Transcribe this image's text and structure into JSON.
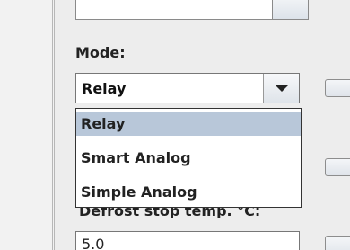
{
  "mode_section": {
    "label": "Mode:",
    "selected_value": "Relay",
    "options": [
      "Relay",
      "Smart Analog",
      "Simple Analog"
    ],
    "highlighted_option_index": 0
  },
  "defrost_section": {
    "label": "Defrost stop temp. °C:",
    "value": "5.0"
  },
  "colors": {
    "panel_background": "#ededed",
    "selection_highlight": "#b8c7d9"
  },
  "icons": {
    "combo_arrow": "chevron-down-icon"
  }
}
